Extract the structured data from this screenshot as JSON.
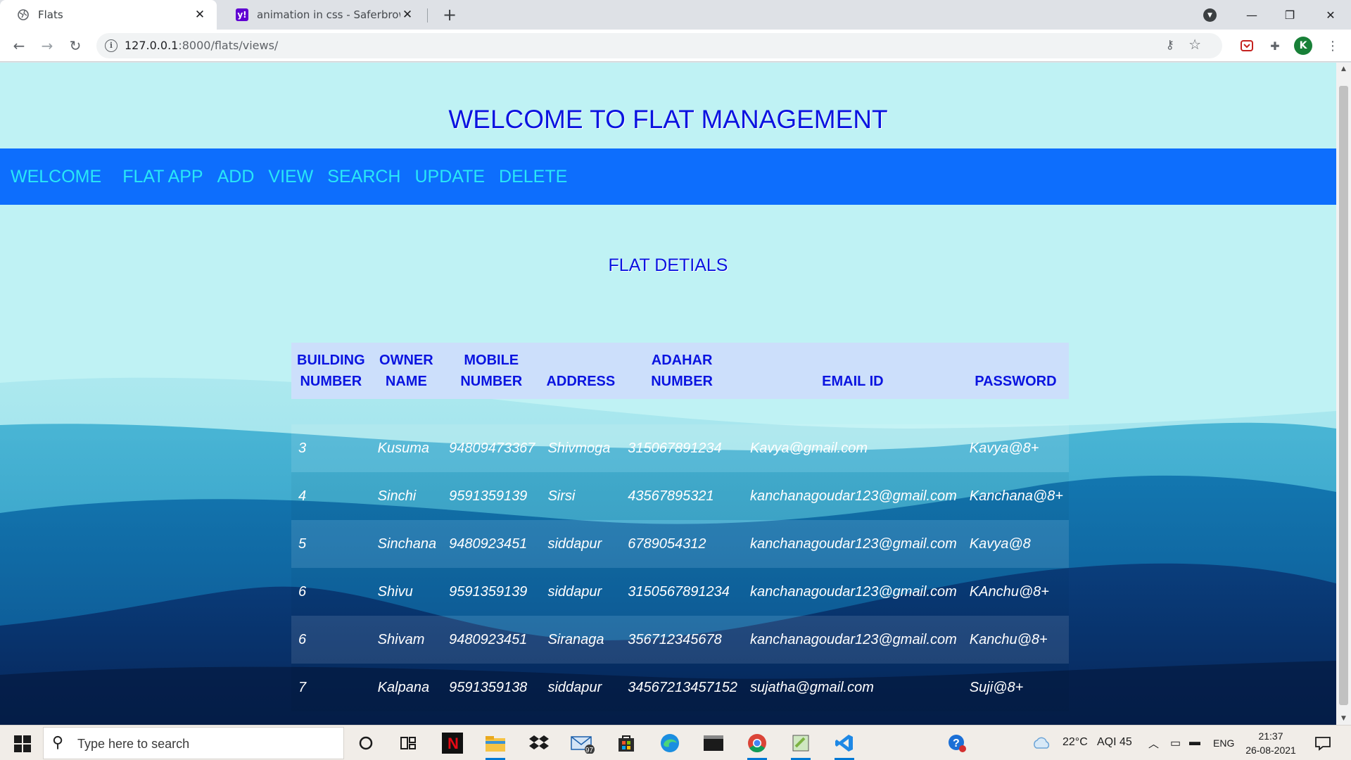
{
  "browser": {
    "tabs": [
      {
        "title": "Flats",
        "active": true
      },
      {
        "title": "animation in css - Saferbrowser Y",
        "active": false
      }
    ],
    "new_tab_label": "+",
    "url_host": "127.0.0.1",
    "url_path": ":8000/flats/views/",
    "profile_initial": "K"
  },
  "page": {
    "heading": "WELCOME TO FLAT MANAGEMENT",
    "nav": [
      "WELCOME",
      "FLAT APP",
      "ADD",
      "VIEW",
      "SEARCH",
      "UPDATE",
      "DELETE"
    ],
    "subtitle": "FLAT DETIALS",
    "table": {
      "columns": [
        {
          "line1": "BUILDING",
          "line2": "NUMBER"
        },
        {
          "line1": "OWNER",
          "line2": "NAME"
        },
        {
          "line1": "MOBILE",
          "line2": "NUMBER"
        },
        {
          "line1": "",
          "line2": "ADDRESS"
        },
        {
          "line1": "ADAHAR",
          "line2": "NUMBER"
        },
        {
          "line1": "",
          "line2": "EMAIL ID"
        },
        {
          "line1": "",
          "line2": "PASSWORD"
        }
      ],
      "rows": [
        [
          "3",
          "Kusuma",
          "94809473367",
          "Shivmoga",
          "315067891234",
          "Kavya@gmail.com",
          "Kavya@8+"
        ],
        [
          "4",
          "Sinchi",
          "9591359139",
          "Sirsi",
          "43567895321",
          "kanchanagoudar123@gmail.com",
          "Kanchana@8+"
        ],
        [
          "5",
          "Sinchana",
          "9480923451",
          "siddapur",
          "6789054312",
          "kanchanagoudar123@gmail.com",
          "Kavya@8"
        ],
        [
          "6",
          "Shivu",
          "9591359139",
          "siddapur",
          "3150567891234",
          "kanchanagoudar123@gmail.com",
          "KAnchu@8+"
        ],
        [
          "6",
          "Shivam",
          "9480923451",
          "Siranaga",
          "356712345678",
          "kanchanagoudar123@gmail.com",
          "Kanchu@8+"
        ],
        [
          "7",
          "Kalpana",
          "9591359138",
          "siddapur",
          "34567213457152",
          "sujatha@gmail.com",
          "Suji@8+"
        ]
      ]
    }
  },
  "taskbar": {
    "search_placeholder": "Type here to search",
    "mail_badge": "97",
    "weather": "22°C",
    "aqi": "AQI 45",
    "language": "ENG",
    "time": "21:37",
    "date": "26-08-2021"
  },
  "colors": {
    "page_bg": "#bff2f4",
    "heading": "#0a14e0",
    "navbar": "#0d6efd",
    "nav_text": "#29e7f7",
    "table_header_bg": "#ccdffb"
  }
}
